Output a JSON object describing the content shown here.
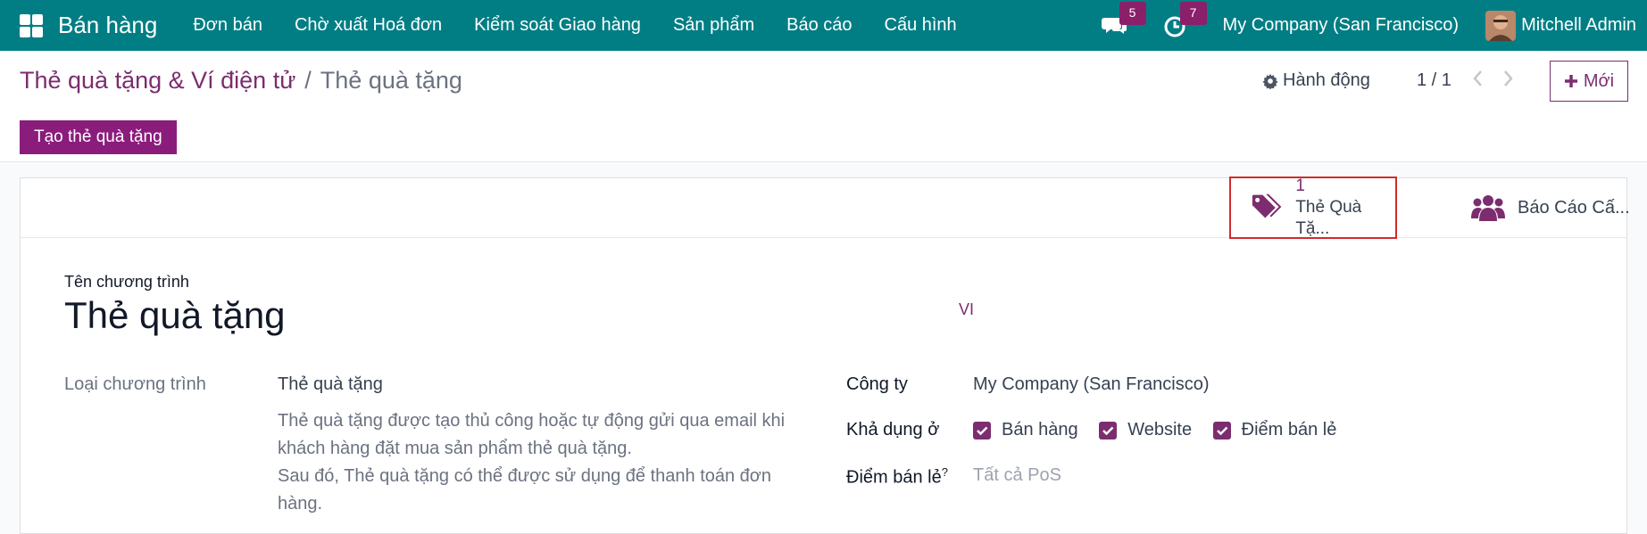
{
  "navbar": {
    "app_name": "Bán hàng",
    "menu": [
      "Đơn bán",
      "Chờ xuất Hoá đơn",
      "Kiểm soát Giao hàng",
      "Sản phẩm",
      "Báo cáo",
      "Cấu hình"
    ],
    "messages_count": "5",
    "activities_count": "7",
    "company": "My Company (San Francisco)",
    "user": "Mitchell Admin"
  },
  "breadcrumb": {
    "parent": "Thẻ quà tặng & Ví điện tử",
    "separator": "/",
    "current": "Thẻ quà tặng"
  },
  "control": {
    "action_label": "Hành động",
    "pager": "1 / 1",
    "new_label": "Mới"
  },
  "statusbar": {
    "create_button": "Tạo thẻ quà tặng"
  },
  "smart_buttons": {
    "gift_cards_count": "1",
    "gift_cards_label": "Thẻ Quà Tặ...",
    "reports_label": "Báo Cáo Cấ..."
  },
  "form": {
    "program_name_label": "Tên chương trình",
    "program_name": "Thẻ quà tặng",
    "lang": "VI",
    "program_type_label": "Loại chương trình",
    "program_type_value": "Thẻ quà tặng",
    "program_type_desc_1": "Thẻ quà tặng được tạo thủ công hoặc tự động gửi qua email khi khách hàng đặt mua sản phẩm thẻ quà tặng.",
    "program_type_desc_2": "Sau đó, Thẻ quà tặng có thể được sử dụng để thanh toán đơn hàng.",
    "company_label": "Công ty",
    "company_value": "My Company (San Francisco)",
    "available_label": "Khả dụng ở",
    "available_options": [
      "Bán hàng",
      "Website",
      "Điểm bán lẻ"
    ],
    "pos_label": "Điểm bán lẻ",
    "pos_help": "?",
    "pos_placeholder": "Tất cả PoS"
  },
  "colors": {
    "navbar": "#017e84",
    "accent": "#7c2d6f",
    "highlight": "#d12b2b"
  }
}
